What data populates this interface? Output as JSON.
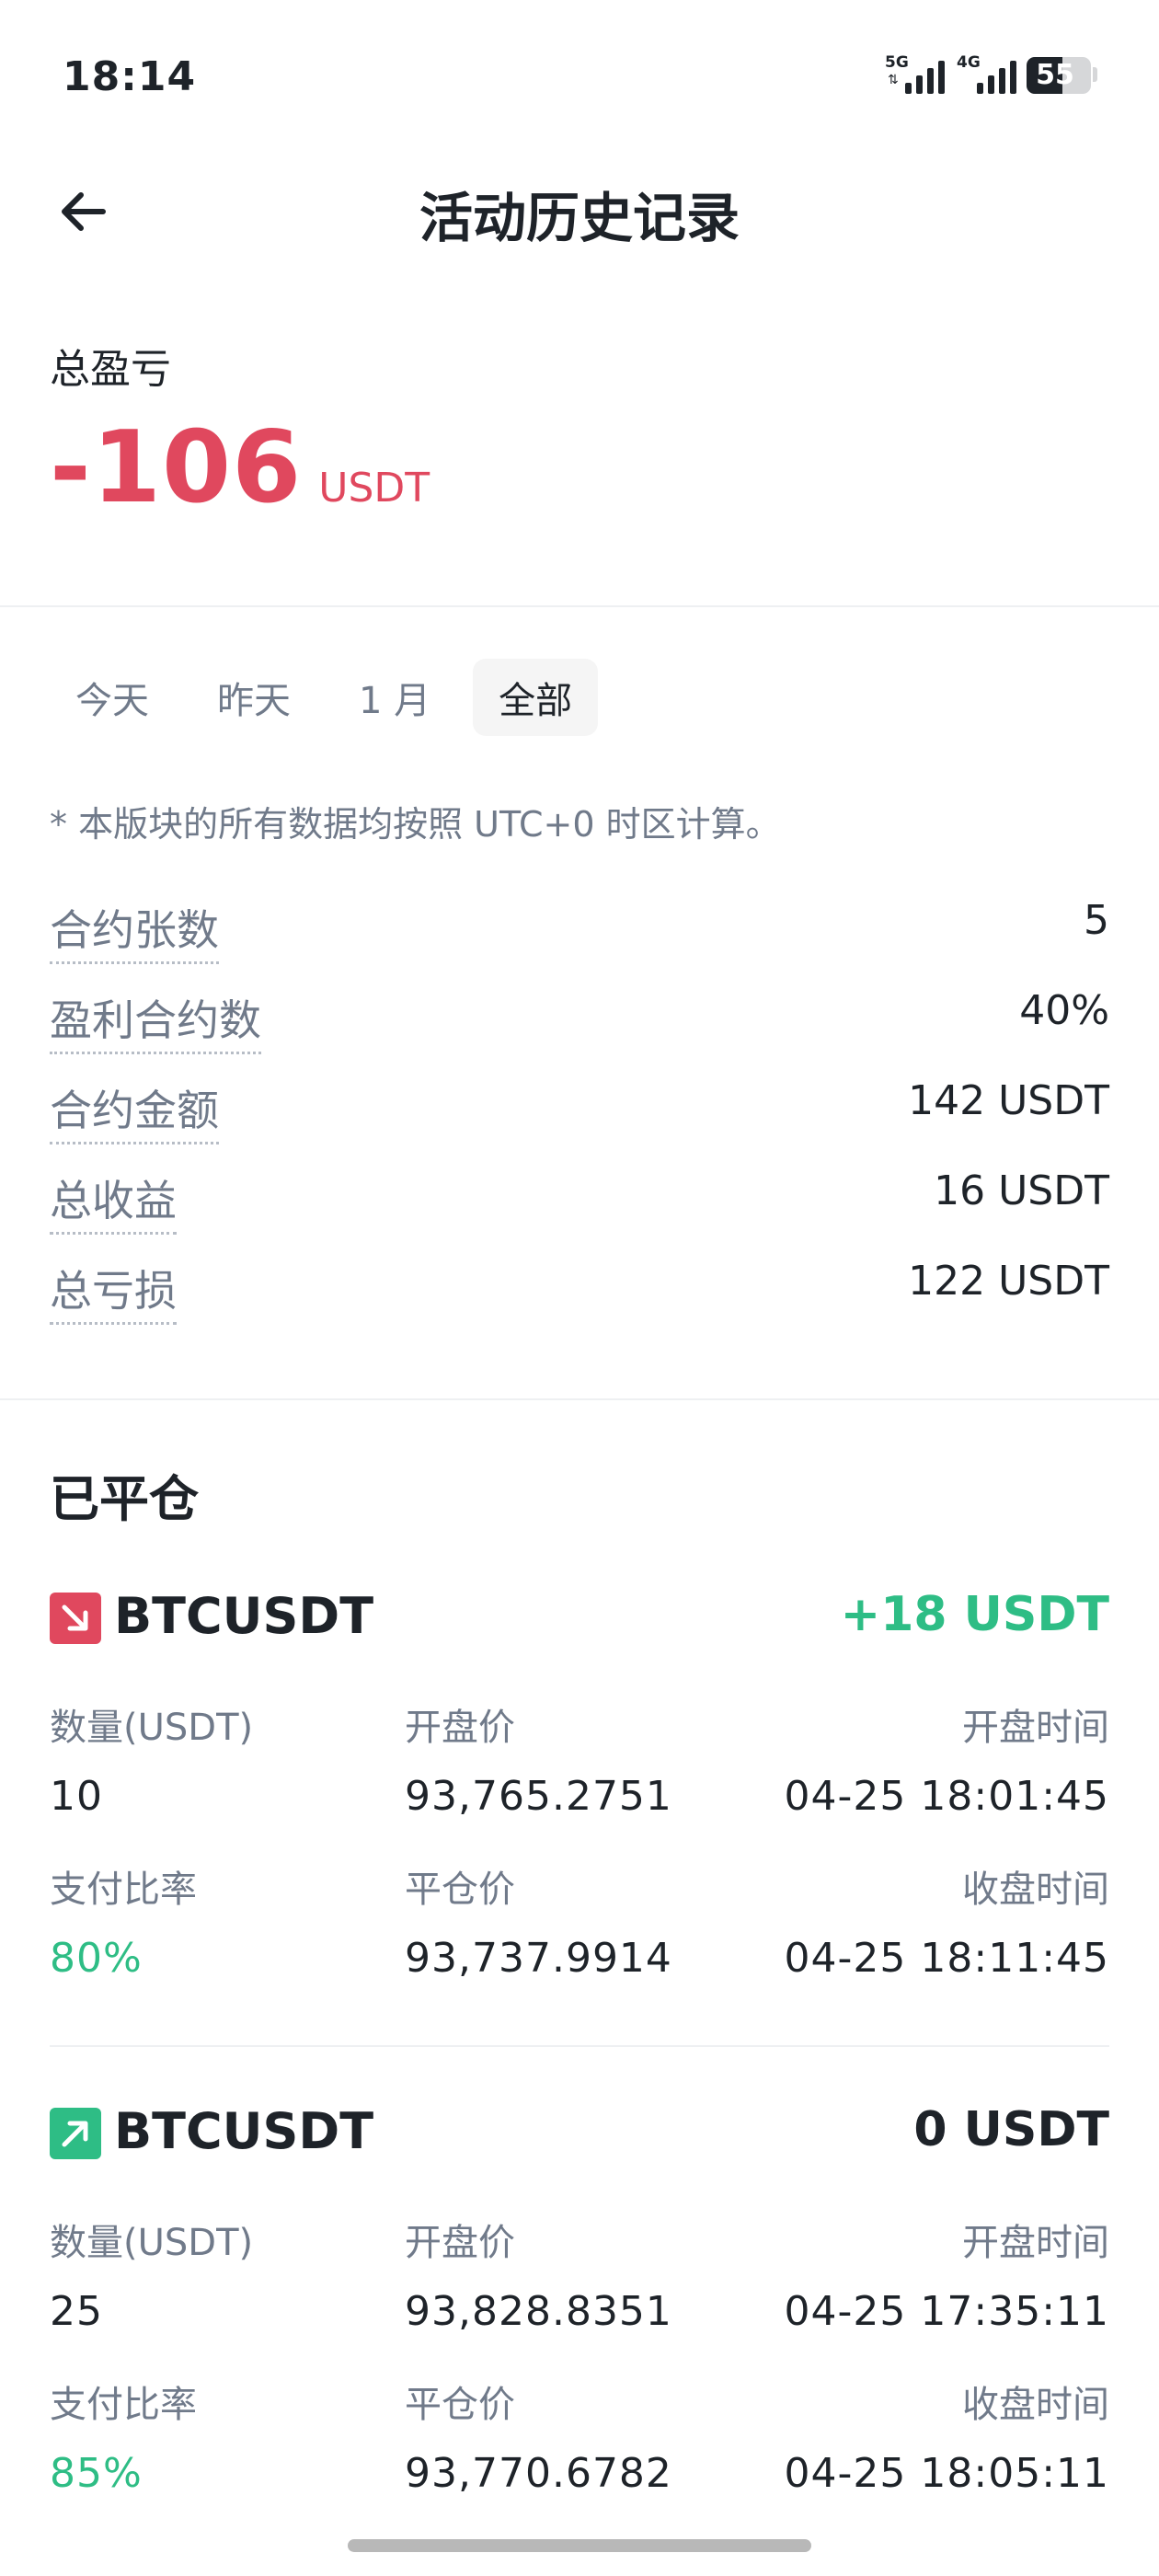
{
  "status_bar": {
    "time": "18:14",
    "signal1_tag": "5G",
    "signal2_tag": "4G",
    "battery_level": "55"
  },
  "header": {
    "title": "活动历史记录",
    "back_icon": "arrow-left-icon"
  },
  "pnl": {
    "label": "总盈亏",
    "value": "-106",
    "unit": "USDT",
    "color": "#e0485e"
  },
  "tabs": [
    {
      "label": "今天",
      "active": false
    },
    {
      "label": "昨天",
      "active": false
    },
    {
      "label": "1 月",
      "active": false
    },
    {
      "label": "全部",
      "active": true
    }
  ],
  "note": "* 本版块的所有数据均按照 UTC+0 时区计算。",
  "stats": [
    {
      "label": "合约张数",
      "value": "5"
    },
    {
      "label": "盈利合约数",
      "value": "40%"
    },
    {
      "label": "合约金额",
      "value": "142 USDT"
    },
    {
      "label": "总收益",
      "value": "16 USDT"
    },
    {
      "label": "总亏损",
      "value": "122 USDT"
    }
  ],
  "closed": {
    "title": "已平仓",
    "trades": [
      {
        "direction": "down",
        "icon": "arrow-down-right-icon",
        "symbol": "BTCUSDT",
        "pnl": "+18 USDT",
        "qty_label": "数量(USDT)",
        "qty": "10",
        "open_price_label": "开盘价",
        "open_price": "93,765.2751",
        "open_time_label": "开盘时间",
        "open_time": "04-25 18:01:45",
        "payout_label": "支付比率",
        "payout": "80%",
        "close_price_label": "平仓价",
        "close_price": "93,737.9914",
        "close_time_label": "收盘时间",
        "close_time": "04-25 18:11:45"
      },
      {
        "direction": "up",
        "icon": "arrow-up-right-icon",
        "symbol": "BTCUSDT",
        "pnl": "0 USDT",
        "qty_label": "数量(USDT)",
        "qty": "25",
        "open_price_label": "开盘价",
        "open_price": "93,828.8351",
        "open_time_label": "开盘时间",
        "open_time": "04-25 17:35:11",
        "payout_label": "支付比率",
        "payout": "85%",
        "close_price_label": "平仓价",
        "close_price": "93,770.6782",
        "close_time_label": "收盘时间",
        "close_time": "04-25 18:05:11"
      }
    ]
  },
  "colors": {
    "loss": "#e0485e",
    "gain": "#2ebd85",
    "text_primary": "#1e2329",
    "text_secondary": "#707a8a"
  }
}
